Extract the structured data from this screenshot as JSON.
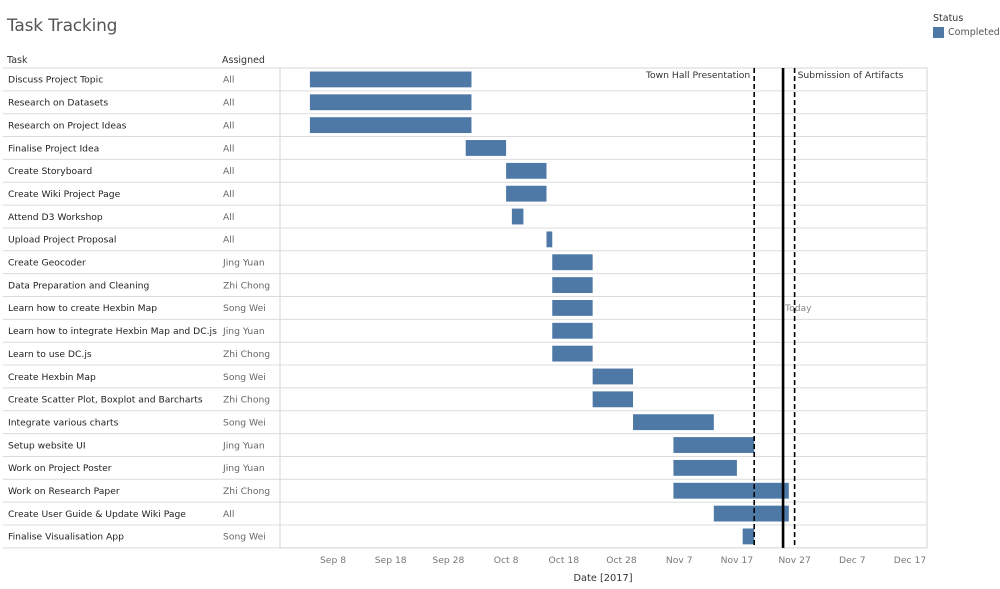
{
  "title": "Task Tracking",
  "legend": {
    "title": "Status",
    "items": [
      {
        "label": "Completed",
        "color": "#4e79a7"
      }
    ]
  },
  "columns": {
    "task": "Task",
    "assigned": "Assigned"
  },
  "chart_data": {
    "type": "gantt",
    "title": "Task Tracking",
    "xlabel": "Date [2017]",
    "ylabel": "Task",
    "xlim": [
      "2017-09-03",
      "2017-12-21"
    ],
    "x_ticks": [
      {
        "date": "2017-09-08",
        "label": "Sep 8"
      },
      {
        "date": "2017-09-18",
        "label": "Sep 18"
      },
      {
        "date": "2017-09-28",
        "label": "Sep 28"
      },
      {
        "date": "2017-10-08",
        "label": "Oct 8"
      },
      {
        "date": "2017-10-18",
        "label": "Oct 18"
      },
      {
        "date": "2017-10-28",
        "label": "Oct 28"
      },
      {
        "date": "2017-11-07",
        "label": "Nov 7"
      },
      {
        "date": "2017-11-17",
        "label": "Nov 17"
      },
      {
        "date": "2017-11-27",
        "label": "Nov 27"
      },
      {
        "date": "2017-12-07",
        "label": "Dec 7"
      },
      {
        "date": "2017-12-17",
        "label": "Dec 17"
      }
    ],
    "grid": true,
    "legend_position": "top-right",
    "series": [
      {
        "name": "Completed",
        "color": "#4e79a7"
      }
    ],
    "tasks": [
      {
        "task": "Discuss Project Topic",
        "assigned": "All",
        "start": "2017-09-04",
        "end": "2017-10-02",
        "status": "Completed"
      },
      {
        "task": "Research on Datasets",
        "assigned": "All",
        "start": "2017-09-04",
        "end": "2017-10-02",
        "status": "Completed"
      },
      {
        "task": "Research on Project Ideas",
        "assigned": "All",
        "start": "2017-09-04",
        "end": "2017-10-02",
        "status": "Completed"
      },
      {
        "task": "Finalise Project Idea",
        "assigned": "All",
        "start": "2017-10-01",
        "end": "2017-10-08",
        "status": "Completed"
      },
      {
        "task": "Create Storyboard",
        "assigned": "All",
        "start": "2017-10-08",
        "end": "2017-10-15",
        "status": "Completed"
      },
      {
        "task": "Create Wiki Project Page",
        "assigned": "All",
        "start": "2017-10-08",
        "end": "2017-10-15",
        "status": "Completed"
      },
      {
        "task": "Attend D3 Workshop",
        "assigned": "All",
        "start": "2017-10-09",
        "end": "2017-10-11",
        "status": "Completed"
      },
      {
        "task": "Upload Project Proposal",
        "assigned": "All",
        "start": "2017-10-15",
        "end": "2017-10-16",
        "status": "Completed"
      },
      {
        "task": "Create Geocoder",
        "assigned": "Jing Yuan",
        "start": "2017-10-16",
        "end": "2017-10-23",
        "status": "Completed"
      },
      {
        "task": "Data Preparation and Cleaning",
        "assigned": "Zhi Chong",
        "start": "2017-10-16",
        "end": "2017-10-23",
        "status": "Completed"
      },
      {
        "task": "Learn how to create Hexbin Map",
        "assigned": "Song Wei",
        "start": "2017-10-16",
        "end": "2017-10-23",
        "status": "Completed"
      },
      {
        "task": "Learn how to integrate Hexbin Map and DC.js",
        "assigned": "Jing Yuan",
        "start": "2017-10-16",
        "end": "2017-10-23",
        "status": "Completed"
      },
      {
        "task": "Learn to use DC.js",
        "assigned": "Zhi Chong",
        "start": "2017-10-16",
        "end": "2017-10-23",
        "status": "Completed"
      },
      {
        "task": "Create Hexbin Map",
        "assigned": "Song Wei",
        "start": "2017-10-23",
        "end": "2017-10-30",
        "status": "Completed"
      },
      {
        "task": "Create Scatter Plot, Boxplot and Barcharts",
        "assigned": "Zhi Chong",
        "start": "2017-10-23",
        "end": "2017-10-30",
        "status": "Completed"
      },
      {
        "task": "Integrate various charts",
        "assigned": "Song Wei",
        "start": "2017-10-30",
        "end": "2017-11-13",
        "status": "Completed"
      },
      {
        "task": "Setup website UI",
        "assigned": "Jing Yuan",
        "start": "2017-11-06",
        "end": "2017-11-20",
        "status": "Completed"
      },
      {
        "task": "Work on Project Poster",
        "assigned": "Jing Yuan",
        "start": "2017-11-06",
        "end": "2017-11-17",
        "status": "Completed"
      },
      {
        "task": "Work on Research Paper",
        "assigned": "Zhi Chong",
        "start": "2017-11-06",
        "end": "2017-11-26",
        "status": "Completed"
      },
      {
        "task": "Create User Guide & Update Wiki Page",
        "assigned": "All",
        "start": "2017-11-13",
        "end": "2017-11-26",
        "status": "Completed"
      },
      {
        "task": "Finalise Visualisation App",
        "assigned": "Song Wei",
        "start": "2017-11-18",
        "end": "2017-11-20",
        "status": "Completed"
      }
    ],
    "reference_lines": [
      {
        "label": "Town Hall Presentation",
        "date": "2017-11-20",
        "style": "dashed",
        "label_side": "left"
      },
      {
        "label": "Today",
        "date": "2017-11-25",
        "style": "solid",
        "label_side": "right"
      },
      {
        "label": "Submission of Artifacts",
        "date": "2017-11-27",
        "style": "dashed",
        "label_side": "right"
      }
    ]
  }
}
